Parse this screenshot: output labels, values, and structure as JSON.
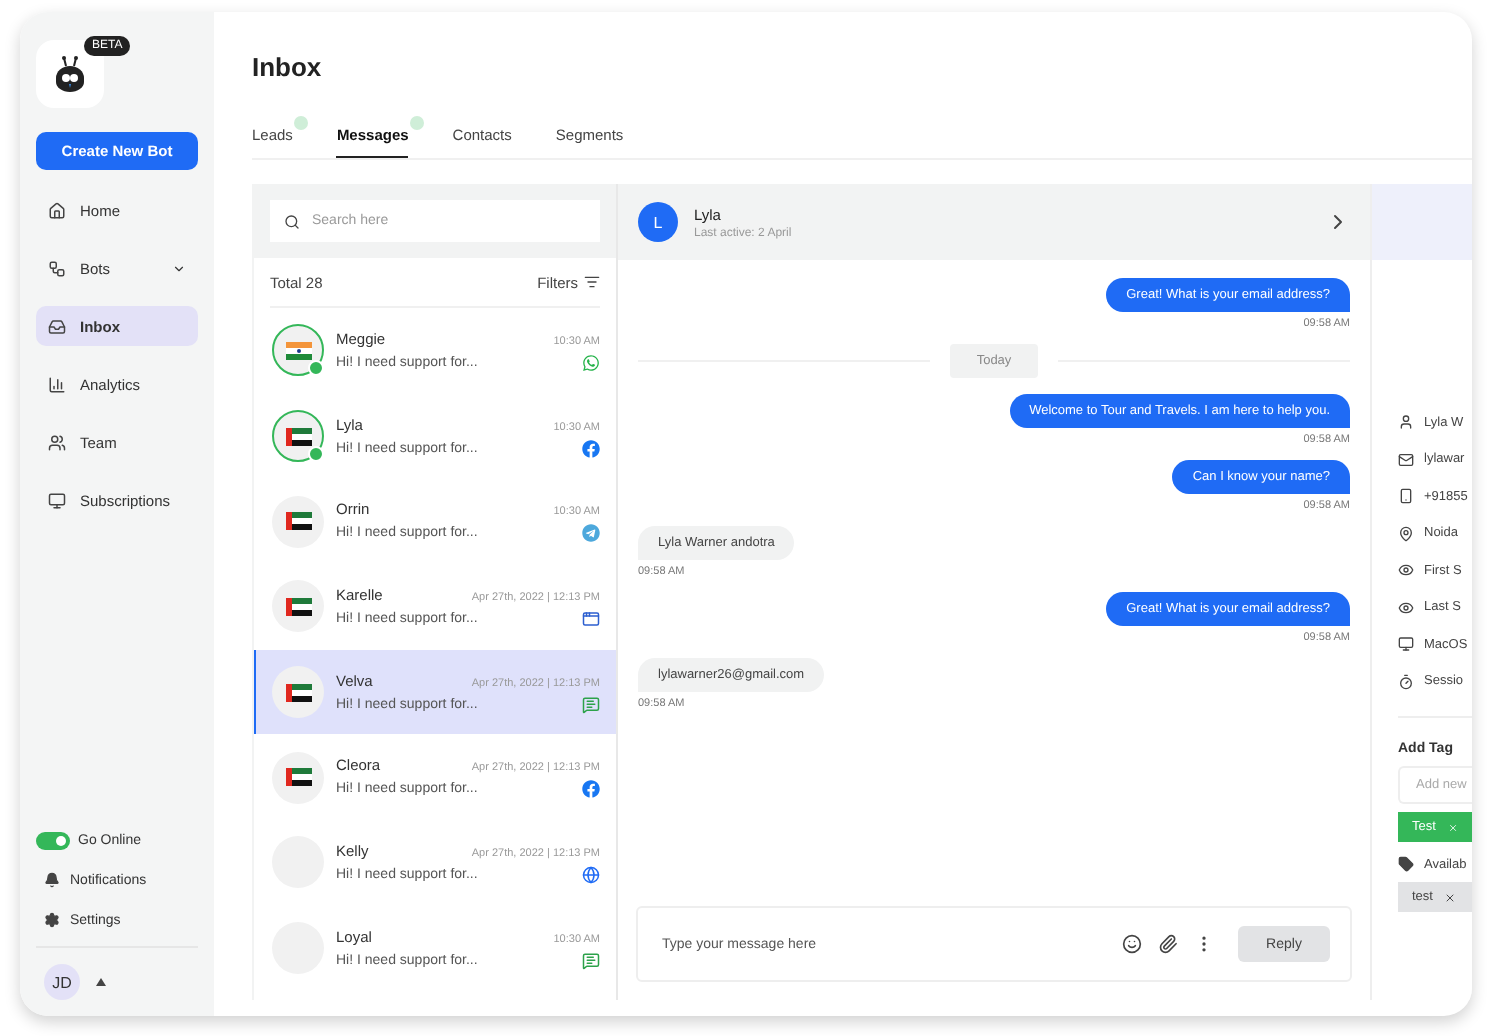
{
  "sidebar": {
    "beta_badge": "BETA",
    "create_button": "Create New Bot",
    "items": [
      {
        "kind": "home",
        "label": "Home",
        "selected": false,
        "has_caret": false
      },
      {
        "kind": "bots",
        "label": "Bots",
        "selected": false,
        "has_caret": true
      },
      {
        "kind": "inbox",
        "label": "Inbox",
        "selected": true,
        "has_caret": false
      },
      {
        "kind": "analytics",
        "label": "Analytics",
        "selected": false,
        "has_caret": false
      },
      {
        "kind": "team",
        "label": "Team",
        "selected": false,
        "has_caret": false
      },
      {
        "kind": "subscriptions",
        "label": "Subscriptions",
        "selected": false,
        "has_caret": false
      }
    ],
    "online_toggle": {
      "label": "Go Online",
      "on": true
    },
    "bottom_items": [
      {
        "kind": "notifications",
        "label": "Notifications"
      },
      {
        "kind": "settings",
        "label": "Settings"
      }
    ],
    "user": {
      "initials": "JD"
    }
  },
  "page_title": "Inbox",
  "tabs": [
    {
      "label": "Leads",
      "selected": false,
      "badge": true
    },
    {
      "label": "Messages",
      "selected": true,
      "badge": true
    },
    {
      "label": "Contacts",
      "selected": false,
      "badge": false
    },
    {
      "label": "Segments",
      "selected": false,
      "badge": false
    }
  ],
  "conversations": {
    "search": {
      "placeholder": "Search here"
    },
    "total": "Total 28",
    "filters": "Filters",
    "items": [
      {
        "name": "Meggie",
        "time": "10:30 AM",
        "preview": "Hi! I need support for...",
        "flag": {
          "kind": "india"
        },
        "online": true,
        "channel": {
          "kind": "whatsapp"
        },
        "selected": false
      },
      {
        "name": "Lyla",
        "time": "10:30 AM",
        "preview": "Hi! I need support for...",
        "flag": {
          "kind": "uae"
        },
        "online": true,
        "channel": {
          "kind": "facebook"
        },
        "selected": false
      },
      {
        "name": "Orrin",
        "time": "10:30 AM",
        "preview": "Hi! I need support for...",
        "flag": {
          "kind": "uae"
        },
        "online": false,
        "channel": {
          "kind": "telegram"
        },
        "selected": false
      },
      {
        "name": "Karelle",
        "time": "Apr 27th, 2022 | 12:13 PM",
        "preview": "Hi! I need support for...",
        "flag": {
          "kind": "uae"
        },
        "online": false,
        "channel": {
          "kind": "widget"
        },
        "selected": false
      },
      {
        "name": "Velva",
        "time": "Apr 27th, 2022 | 12:13 PM",
        "preview": "Hi! I need support for...",
        "flag": {
          "kind": "uae"
        },
        "online": false,
        "channel": {
          "kind": "sms"
        },
        "selected": true
      },
      {
        "name": "Cleora",
        "time": "Apr 27th, 2022 | 12:13 PM",
        "preview": "Hi! I need support for...",
        "flag": {
          "kind": "uae"
        },
        "online": false,
        "channel": {
          "kind": "facebook"
        },
        "selected": false
      },
      {
        "name": "Kelly",
        "time": "Apr 27th, 2022 | 12:13 PM",
        "preview": "Hi! I need support for...",
        "flag": {
          "kind": "none"
        },
        "online": false,
        "channel": {
          "kind": "web"
        },
        "selected": false
      },
      {
        "name": "Loyal",
        "time": "10:30 AM",
        "preview": "Hi! I need support for...",
        "flag": {
          "kind": "none"
        },
        "online": false,
        "channel": {
          "kind": "sms"
        },
        "selected": false
      }
    ]
  },
  "chat": {
    "contact": {
      "initial": "L",
      "name": "Lyla",
      "last_active": "Last active: 2 April"
    },
    "messages": [
      {
        "kind": "outgoing",
        "text": "Great! What is your email address?",
        "time": "09:58 AM"
      },
      {
        "kind": "divider",
        "text": "Today"
      },
      {
        "kind": "outgoing",
        "text": "Welcome to Tour and Travels. I am here to help you.",
        "time": "09:58 AM"
      },
      {
        "kind": "outgoing",
        "text": "Can I know your name?",
        "time": "09:58 AM"
      },
      {
        "kind": "incoming",
        "text": "Lyla Warner andotra",
        "time": "09:58 AM"
      },
      {
        "kind": "outgoing",
        "text": "Great! What is your email address?",
        "time": "09:58 AM"
      },
      {
        "kind": "incoming",
        "text": "lylawarner26@gmail.com",
        "time": "09:58 AM"
      }
    ],
    "composer": {
      "placeholder": "Type your message here",
      "reply": "Reply"
    }
  },
  "details": {
    "items": [
      {
        "kind": "person",
        "text": "Lyla W"
      },
      {
        "kind": "mail",
        "text": "lylawar"
      },
      {
        "kind": "phone",
        "text": "+91855"
      },
      {
        "kind": "location",
        "text": "Noida"
      },
      {
        "kind": "eye",
        "text": "First S"
      },
      {
        "kind": "eye",
        "text": "Last S"
      },
      {
        "kind": "monitor",
        "text": "MacOS"
      },
      {
        "kind": "timer",
        "text": "Sessio"
      }
    ],
    "add_tag": {
      "title": "Add Tag",
      "placeholder": "Add new"
    },
    "added_tags": [
      {
        "label": "Test",
        "color": "#34b759"
      }
    ],
    "available": {
      "label": "Availab",
      "tags": [
        {
          "label": "test"
        }
      ]
    }
  }
}
